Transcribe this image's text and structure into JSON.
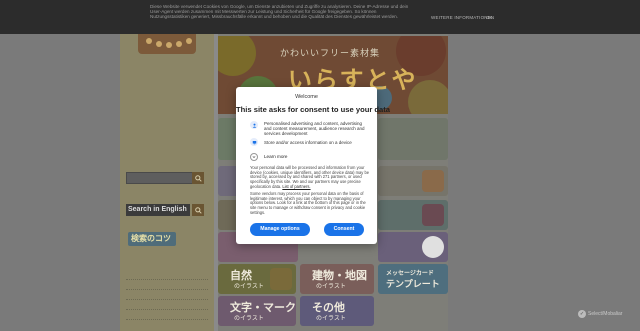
{
  "cookie_bar": {
    "text": "Diese Website verwendet Cookies von Google, um Dienste anzubieten und Zugriffe zu analysieren. Deine IP-Adresse und dein User-Agent werden zusammen mit Messwerten zur Leistung und Sicherheit für Google freigegeben. So können Nutzungsstatistiken generiert, Missbrauchsfälle erkannt und behoben und die Qualität des Dienstes gewährleistet werden.",
    "more_info": "WEITERE INFORMATIONEN",
    "ok": "OK"
  },
  "site": {
    "banner_subtitle": "かわいいフリー素材集",
    "banner_title": "いらすとや",
    "sidebar_search_en": "Search in English",
    "sidebar_badge": "検索のコツ",
    "tiles": [
      {
        "main": "自然",
        "sub": "のイラスト"
      },
      {
        "main": "建物・地図",
        "sub": "のイラスト"
      },
      {
        "main": "メッセージカード",
        "sub": "テンプレート"
      },
      {
        "main": "文字・マーク",
        "sub": "のイラスト"
      },
      {
        "main": "その他",
        "sub": "のイラスト"
      }
    ]
  },
  "modal": {
    "welcome": "Welcome",
    "title": "This site asks for consent to use your data",
    "purposes": [
      {
        "icon": "person-icon",
        "text": "Personalised advertising and content, advertising and content measurement, audience research and services development"
      },
      {
        "icon": "device-icon",
        "text": "Store and/or access information on a device"
      }
    ],
    "learn_more": "Learn more",
    "body_1": "Your personal data will be processed and information from your device (cookies, unique identifiers, and other device data) may be stored by, accessed by and shared with 271 partners, or used specifically by this site.",
    "body_1_tail": "We and our partners may use precise geolocation data.",
    "partners_link": "List of partners.",
    "body_2": "Some vendors may process your personal data on the basis of legitimate interest, which you can object to by managing your options below. Look for a link at the bottom of this page or in the site menu to manage or withdraw consent in privacy and cookie settings.",
    "manage_options": "Manage options",
    "consent": "Consent"
  },
  "badge": {
    "label": "Select/Mobaliar"
  },
  "colors": {
    "primary_button": "#1a73e8",
    "overlay": "#2c2c2c"
  }
}
